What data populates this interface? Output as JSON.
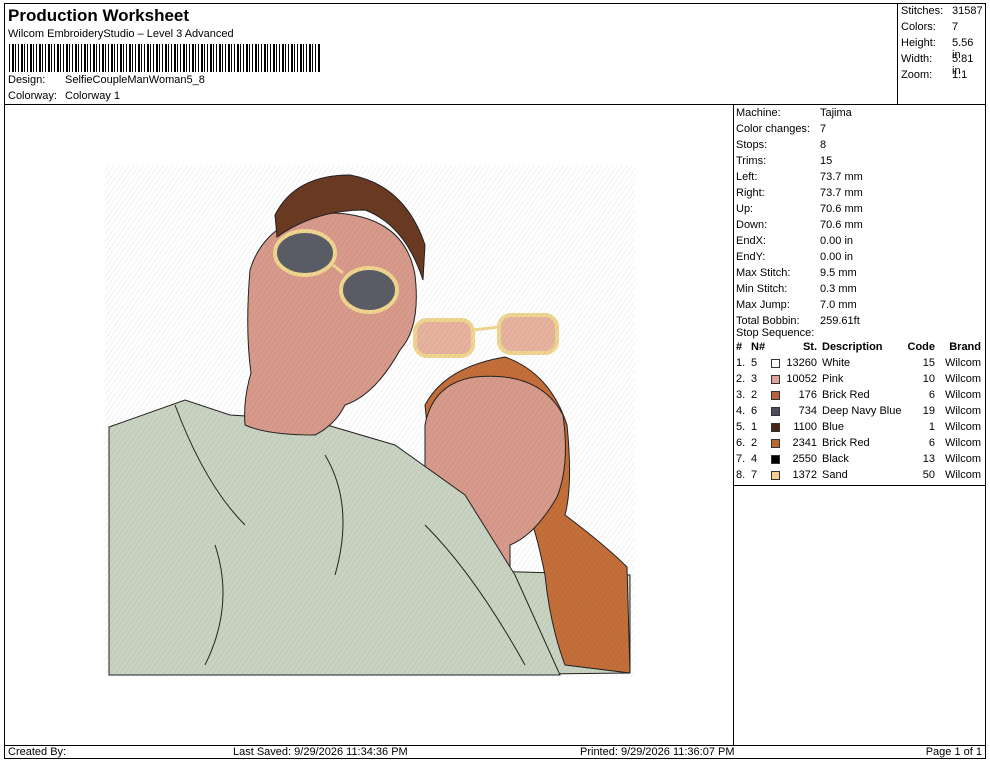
{
  "header": {
    "title": "Production Worksheet",
    "software": "Wilcom EmbroideryStudio – Level 3 Advanced",
    "design_label": "Design:",
    "design_value": "SelfieCoupleManWoman5_8",
    "colorway_label": "Colorway:",
    "colorway_value": "Colorway 1"
  },
  "summary": [
    {
      "label": "Stitches:",
      "value": "31587"
    },
    {
      "label": "Colors:",
      "value": "7"
    },
    {
      "label": "Height:",
      "value": "5.56 in"
    },
    {
      "label": "Width:",
      "value": "5.81 in"
    },
    {
      "label": "Zoom:",
      "value": "1:1"
    }
  ],
  "stats": [
    {
      "label": "Machine:",
      "value": "Tajima"
    },
    {
      "label": "Color changes:",
      "value": "7"
    },
    {
      "label": "Stops:",
      "value": "8"
    },
    {
      "label": "Trims:",
      "value": "15"
    },
    {
      "label": "Left:",
      "value": "73.7 mm"
    },
    {
      "label": "Right:",
      "value": "73.7 mm"
    },
    {
      "label": "Up:",
      "value": "70.6 mm"
    },
    {
      "label": "Down:",
      "value": "70.6 mm"
    },
    {
      "label": "EndX:",
      "value": "0.00 in"
    },
    {
      "label": "EndY:",
      "value": "0.00 in"
    },
    {
      "label": "Max Stitch:",
      "value": "9.5 mm"
    },
    {
      "label": "Min Stitch:",
      "value": "0.3 mm"
    },
    {
      "label": "Max Jump:",
      "value": "7.0 mm"
    },
    {
      "label": "Total Bobbin:",
      "value": "259.61ft"
    }
  ],
  "stop_sequence": {
    "title": "Stop Sequence:",
    "headers": {
      "idx": "#",
      "n": "N#",
      "st": "St.",
      "desc": "Description",
      "code": "Code",
      "brand": "Brand"
    },
    "rows": [
      {
        "idx": "1.",
        "n": "5",
        "color": "#ffffff",
        "st": "13260",
        "desc": "White",
        "code": "15",
        "brand": "Wilcom"
      },
      {
        "idx": "2.",
        "n": "3",
        "color": "#e3a09c",
        "st": "10052",
        "desc": "Pink",
        "code": "10",
        "brand": "Wilcom"
      },
      {
        "idx": "3.",
        "n": "2",
        "color": "#b3623a",
        "st": "176",
        "desc": "Brick Red",
        "code": "6",
        "brand": "Wilcom"
      },
      {
        "idx": "4.",
        "n": "6",
        "color": "#4a4c5a",
        "st": "734",
        "desc": "Deep Navy Blue",
        "code": "19",
        "brand": "Wilcom"
      },
      {
        "idx": "5.",
        "n": "1",
        "color": "#4a2412",
        "st": "1100",
        "desc": "Blue",
        "code": "1",
        "brand": "Wilcom"
      },
      {
        "idx": "6.",
        "n": "2",
        "color": "#b9662f",
        "st": "2341",
        "desc": "Brick Red",
        "code": "6",
        "brand": "Wilcom"
      },
      {
        "idx": "7.",
        "n": "4",
        "color": "#000000",
        "st": "2550",
        "desc": "Black",
        "code": "13",
        "brand": "Wilcom"
      },
      {
        "idx": "8.",
        "n": "7",
        "color": "#f3cf90",
        "st": "1372",
        "desc": "Sand",
        "code": "50",
        "brand": "Wilcom"
      }
    ]
  },
  "footer": {
    "created_by": "Created By:",
    "last_saved": "Last Saved: 9/29/2026 11:34:36 PM",
    "printed": "Printed: 9/29/2026 11:36:07 PM",
    "page": "Page 1 of 1"
  },
  "palette": {
    "shirt": "#c9d3c2",
    "skin": "#d79a8b",
    "man_hair": "#6b3a22",
    "woman_hair": "#c46f3a",
    "glasses_frame": "#f0d58f",
    "lens": "#5b5d66"
  }
}
